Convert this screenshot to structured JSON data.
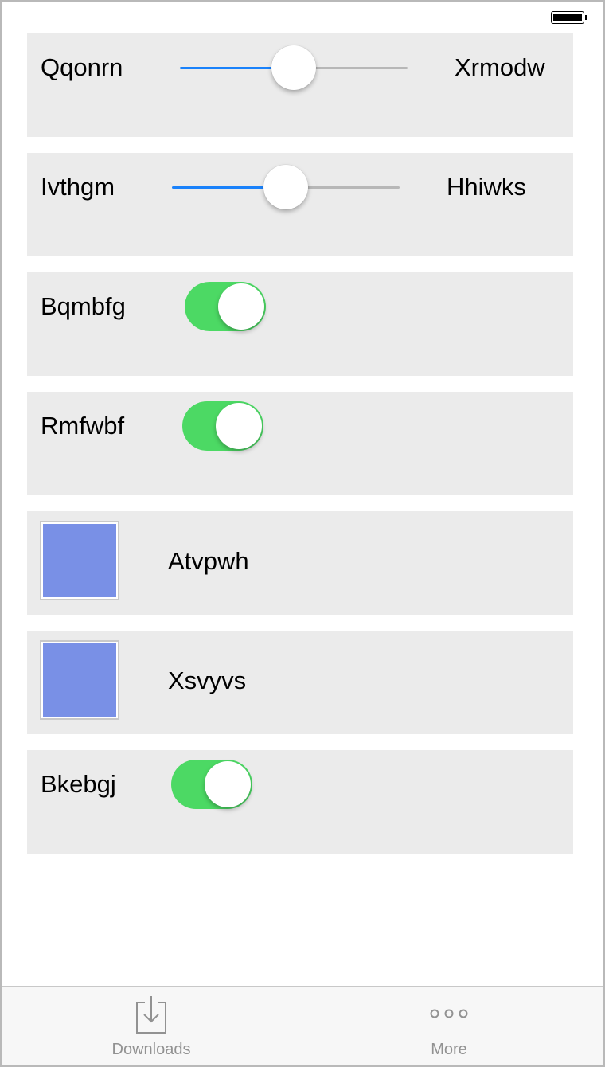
{
  "status_bar": {
    "battery_icon": "battery-full-icon"
  },
  "rows": [
    {
      "type": "slider",
      "left_label": "Qqonrn",
      "right_label": "Xrmodw",
      "value": 0.5
    },
    {
      "type": "slider",
      "left_label": "Ivthgm",
      "right_label": "Hhiwks",
      "value": 0.5
    },
    {
      "type": "switch",
      "label": "Bqmbfg",
      "on": true
    },
    {
      "type": "switch",
      "label": "Rmfwbf",
      "on": true
    },
    {
      "type": "image",
      "label": "Atvpwh",
      "color": "#7990e6"
    },
    {
      "type": "image",
      "label": "Xsvyvs",
      "color": "#7990e6"
    },
    {
      "type": "switch",
      "label": "Bkebgj",
      "on": true
    }
  ],
  "colors": {
    "accent_blue": "#1a82fb",
    "switch_on_green": "#4cd964",
    "row_background": "#ebebeb",
    "tab_inactive": "#929292"
  },
  "tab_bar": {
    "tabs": [
      {
        "label": "Downloads",
        "icon": "downloads-icon"
      },
      {
        "label": "More",
        "icon": "more-icon"
      }
    ]
  }
}
